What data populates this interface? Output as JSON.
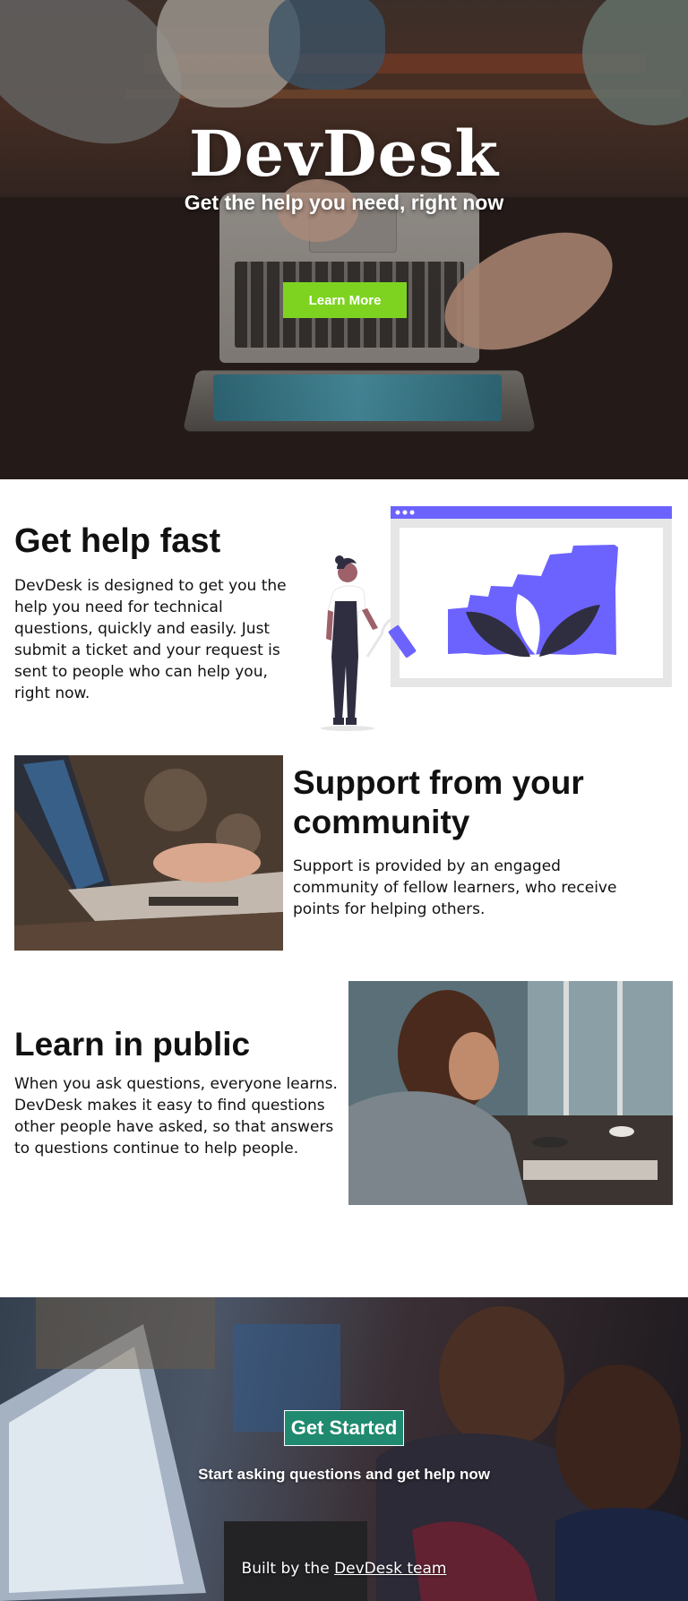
{
  "hero": {
    "title": "DevDesk",
    "tagline": "Get the help you need, right now",
    "cta_label": "Learn More",
    "cta_color": "#7ed320"
  },
  "features": [
    {
      "title": "Get help fast",
      "text": "DevDesk is designed to get you the help you need for technical questions, quickly and easily. Just submit a ticket and your request is sent to people who can help you, right now."
    },
    {
      "title": "Support from your community",
      "text": "Support is provided by an engaged community of fellow learners, who receive points for helping others."
    },
    {
      "title": "Learn in public",
      "text": "When you ask questions, everyone learns. DevDesk makes it easy to find questions other people have asked, so that answers to questions continue to help people."
    }
  ],
  "illustration": {
    "accent_color": "#6c63ff"
  },
  "footer": {
    "cta_label": "Get Started",
    "cta_color": "#1f8a6f",
    "tagline": "Start asking questions and get help now",
    "credit_prefix": "Built by the",
    "credit_link": "DevDesk team"
  }
}
